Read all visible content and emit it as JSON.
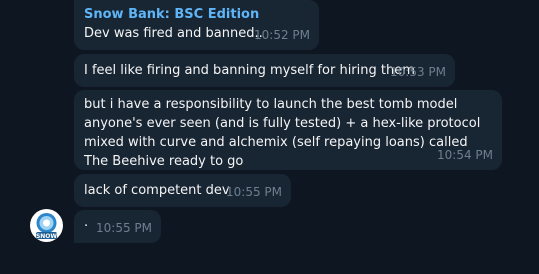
{
  "chat": {
    "sender_name": "Snow Bank: BSC Edition",
    "messages": [
      {
        "text": "Dev was fired and banned..",
        "time": "10:52 PM"
      },
      {
        "text": "I feel like firing and banning myself for hiring them",
        "time": "10:53 PM"
      },
      {
        "text": "but i have a responsibility to launch the best tomb model anyone's ever seen (and is fully tested) + a hex-like protocol mixed with curve and alchemix (self repaying loans) called The Beehive ready to go",
        "time": "10:54 PM"
      },
      {
        "text": "lack of competent dev",
        "time": "10:55 PM"
      },
      {
        "text": "·",
        "time": "10:55 PM"
      }
    ],
    "avatar": {
      "icon": "snow-bank-logo-icon",
      "label": "SNOW"
    }
  },
  "colors": {
    "background": "#0e1621",
    "bubble": "#182533",
    "sender": "#5eb5f7",
    "time": "#6d7f8f",
    "text": "#f5f5f5"
  }
}
